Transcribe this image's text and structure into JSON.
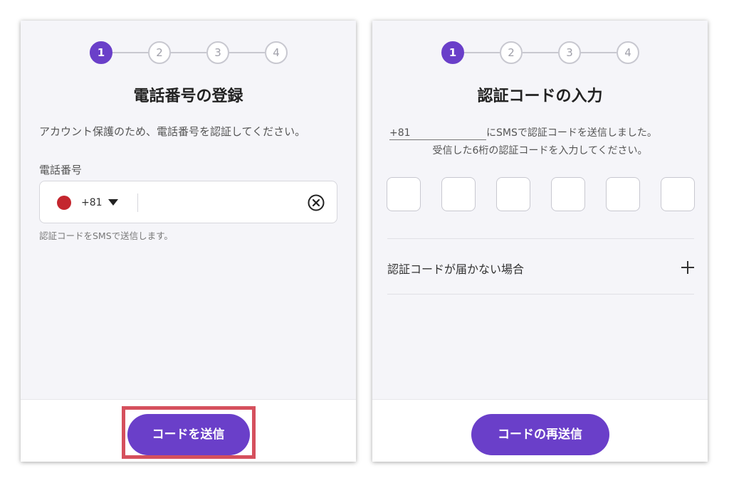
{
  "left_panel": {
    "steps": [
      "1",
      "2",
      "3",
      "4"
    ],
    "active_step": 1,
    "title": "電話番号の登録",
    "description": "アカウント保護のため、電話番号を認証してください。",
    "field_label": "電話番号",
    "country_code": "+81",
    "phone_value": "",
    "helper_text": "認証コードをSMSで送信します。",
    "send_button": "コードを送信"
  },
  "right_panel": {
    "steps": [
      "1",
      "2",
      "3",
      "4"
    ],
    "active_step": 1,
    "title": "認証コードの入力",
    "sent_phone": "+81",
    "sent_suffix": "にSMSで認証コードを送信しました。",
    "instruction": "受信した6桁の認証コードを入力してください。",
    "code_digits": [
      "",
      "",
      "",
      "",
      "",
      ""
    ],
    "accordion_label": "認証コードが届かない場合",
    "resend_button": "コードの再送信"
  },
  "colors": {
    "accent": "#6a3fc9",
    "highlight": "#d5505d",
    "flag_red": "#c4262e"
  },
  "icons": [
    "chevron-down-icon",
    "clear-icon",
    "plus-icon",
    "japan-flag-icon"
  ]
}
